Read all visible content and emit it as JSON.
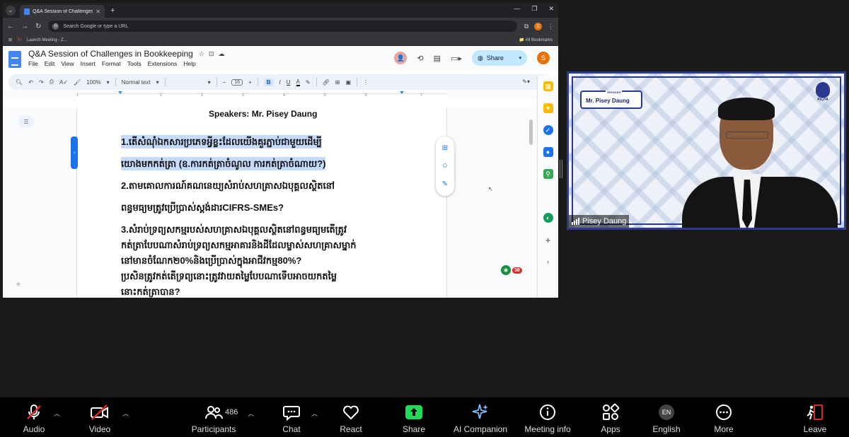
{
  "browser": {
    "tab_title": "Q&A Session of Challenges in",
    "omnibox_placeholder": "Search Google or type a URL",
    "bookmark_meeting": "Launch Meeting - Z...",
    "all_bookmarks": "All Bookmarks",
    "profile_initial": "S"
  },
  "docs": {
    "title": "Q&A Session of Challenges in Bookkeeping",
    "menus": [
      "File",
      "Edit",
      "View",
      "Insert",
      "Format",
      "Tools",
      "Extensions",
      "Help"
    ],
    "share_label": "Share",
    "user_initial": "S",
    "zoom": "100%",
    "style": "Normal text",
    "font_size": "16",
    "ruler_numbers": [
      "1",
      "1",
      "2",
      "3",
      "4",
      "5",
      "6",
      "7"
    ]
  },
  "content": {
    "speakers": "Speakers: Mr. Pisey Daung",
    "q1_line1": "1.តើសំណុំឯកសារប្រភេទអ្វីខ្លះដែលយើងគួរភ្ជាប់ជាមួយដើម្បី",
    "q1_line2": "យោងមកកត់ត្រា (ឧ.ការកត់ត្រាចំណូល ការកត់ត្រាចំណាយ?)",
    "q2_line1": "2.តាមគោលការណ៍គណនេយ្យសំរាប់សហគ្រាសឯបុគ្គលស្ថិតនៅ",
    "q2_line2": "ពន្ធមធ្យមត្រូវប្រើប្រាស់ស្តង់ដារCIFRS-SMEs?",
    "q3_line1": "3.សំរាប់ទ្រព្យសកម្មរបស់សហគ្រាសឯបុគ្គលស្ថិតនៅពន្ធមធ្យមតើត្រូវ",
    "q3_line2": "កត់ត្រាបែបណាសំរាប់ទ្រព្យសកម្មអាគារនិងដីដែលម្ចាស់សហគ្រាសម្នាក់",
    "q3_line3": "នៅមានចំណែក២0%និងប្រើប្រាស់ក្នុងអាជីវកម្ម80%?",
    "q3_line4": "ប្រសិនត្រូវកត់តើទ្រព្យនោះត្រូវវាយតម្លៃបែបណាទើបអាចយកតម្លៃ",
    "q3_line5": "នោះកត់ត្រាបាន?",
    "badge_count": "38"
  },
  "video": {
    "speaker_label": "SPEAKER",
    "speaker_card": "Mr. Pisey Daung",
    "logo_text": "KICPA",
    "participant_name": "Pisey Daung"
  },
  "controls": {
    "audio": "Audio",
    "video": "Video",
    "participants": "Participants",
    "participant_count": "486",
    "chat": "Chat",
    "react": "React",
    "share": "Share",
    "ai_companion": "AI Companion",
    "meeting_info": "Meeting info",
    "apps": "Apps",
    "language_code": "EN",
    "english": "English",
    "more": "More",
    "leave": "Leave"
  },
  "colors": {
    "share_green": "#23d959",
    "leave_red": "#e02828",
    "docs_blue": "#1a73e8",
    "highlight": "#c6dafc"
  }
}
